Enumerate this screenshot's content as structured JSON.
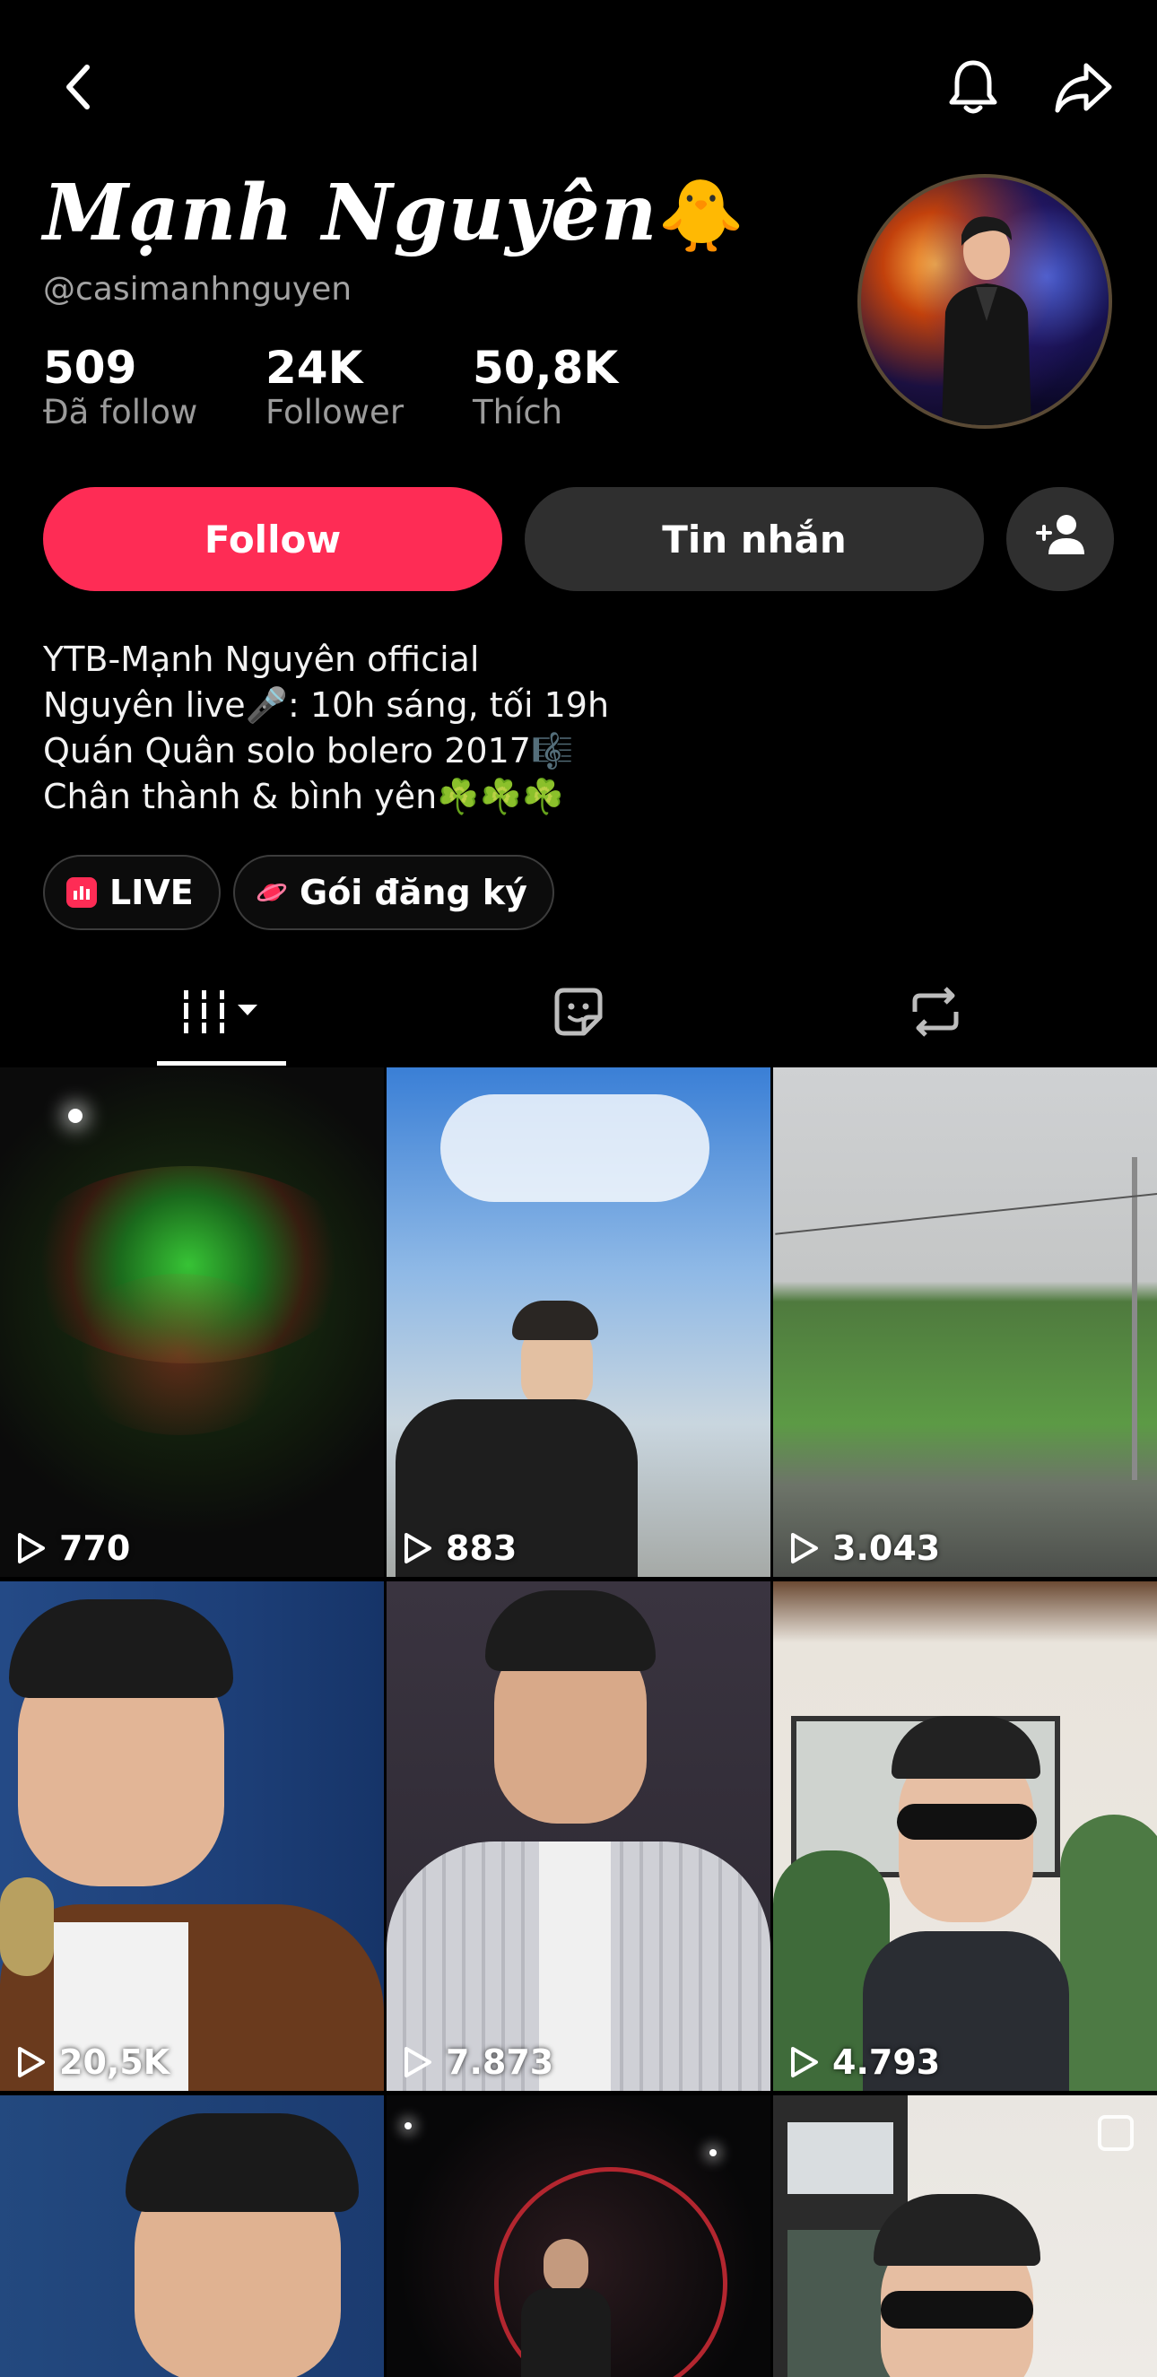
{
  "profile": {
    "display_name": "Mạnh Nguyên",
    "name_emoji": "🐥",
    "handle": "@casimanhnguyen"
  },
  "stats": [
    {
      "value": "509",
      "label": "Đã follow"
    },
    {
      "value": "24K",
      "label": "Follower"
    },
    {
      "value": "50,8K",
      "label": "Thích"
    }
  ],
  "actions": {
    "follow_label": "Follow",
    "message_label": "Tin nhắn"
  },
  "bio": [
    "YTB-Mạnh Nguyên official",
    "Nguyên live🎤: 10h sáng, tối 19h",
    "Quán Quân solo bolero 2017🎼",
    "Chân thành & bình yên☘️☘️☘️"
  ],
  "chips": {
    "live_label": "LIVE",
    "subscription_label": "Gói đăng ký"
  },
  "tabs": [
    "videos-grid-icon",
    "liked-sticker-icon",
    "repost-icon"
  ],
  "videos": [
    {
      "views": "770"
    },
    {
      "views": "883"
    },
    {
      "views": "3.043"
    },
    {
      "views": "20,5K"
    },
    {
      "views": "7.873"
    },
    {
      "views": "4.793"
    },
    {
      "views": ""
    },
    {
      "views": ""
    },
    {
      "views": ""
    }
  ],
  "colors": {
    "accent": "#fe2c55",
    "button_dark": "#2f2f2f",
    "background": "#000000"
  }
}
